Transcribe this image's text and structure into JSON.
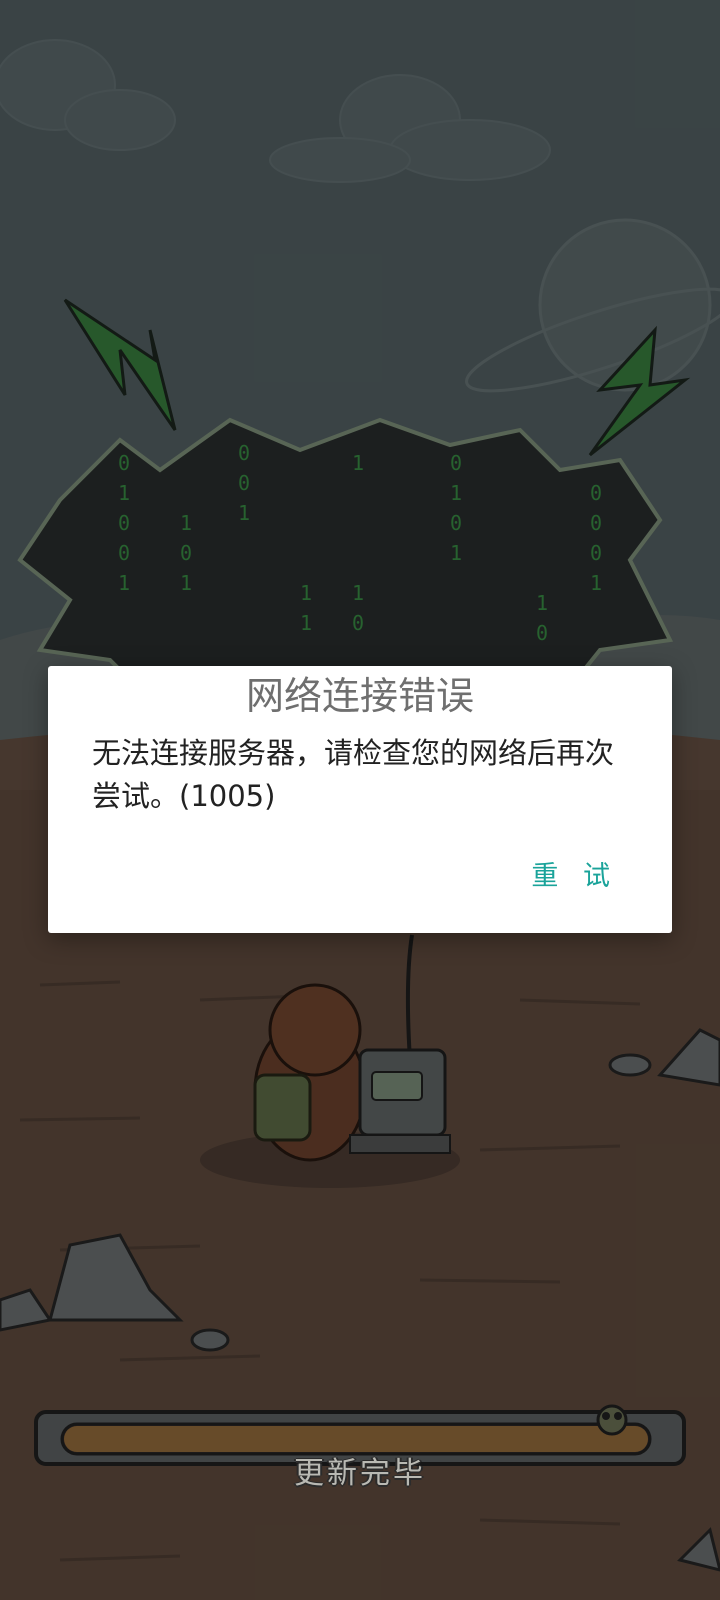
{
  "dialog": {
    "title": "网络连接错误",
    "message": "无法连接服务器，请检查您的网络后再次尝试。(1005)",
    "retry_label": "重 试"
  },
  "loading": {
    "status_text": "更新完毕",
    "progress": 1.0
  },
  "background": {
    "binary_rain": [
      "0",
      "1",
      "0",
      "1",
      "1",
      "0",
      "0",
      "1",
      "1",
      "1",
      "0",
      "1"
    ]
  },
  "colors": {
    "accent": "#1aa39a",
    "progress_fill": "#e8a74a",
    "glitch_green": "#4fbf5a",
    "ground": "#6e5647",
    "sky": "#5d6c70"
  }
}
